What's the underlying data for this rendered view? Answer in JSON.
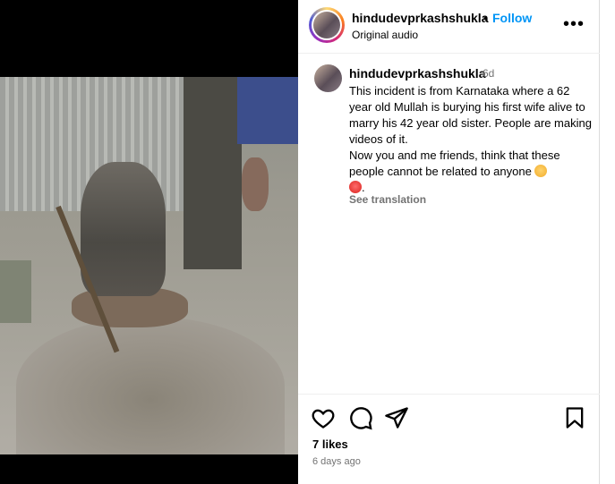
{
  "post": {
    "username": "hindudevprkashshukla",
    "separator": "•",
    "follow_label": "Follow",
    "audio_label": "Original audio",
    "more_label": "•••"
  },
  "comment": {
    "username": "hindudevprkashshukla",
    "time": "6d",
    "text_line1": "This incident is from Karnataka where a 62 year old Mullah is burying his first wife alive to marry his 42 year old sister. People are making videos of it.",
    "text_line2": "Now you and me friends, think that these people cannot be related to anyone",
    "text_end": ".",
    "translate_label": "See translation"
  },
  "footer": {
    "likes": "7 likes",
    "date": "6 days ago"
  },
  "colors": {
    "follow": "#0095f6",
    "muted": "#737373"
  },
  "icons": [
    "heart-icon",
    "comment-icon",
    "share-icon",
    "bookmark-icon",
    "more-icon"
  ]
}
